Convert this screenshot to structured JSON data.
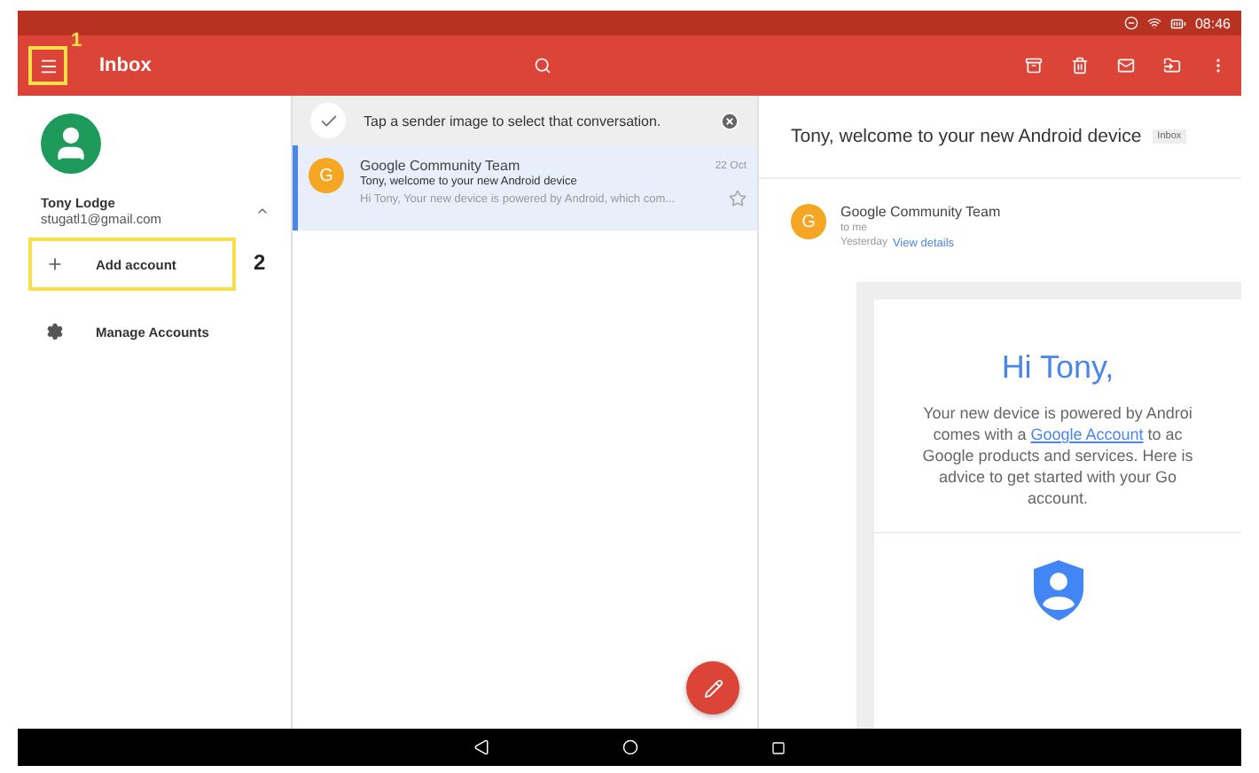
{
  "status_bar": {
    "time": "08:46"
  },
  "toolbar": {
    "title": "Inbox"
  },
  "drawer": {
    "account_name": "Tony Lodge",
    "account_email": "stugatl1@gmail.com",
    "items": [
      {
        "kind": "add",
        "label": "Add account",
        "highlighted": true
      },
      {
        "kind": "manage",
        "label": "Manage Accounts",
        "highlighted": false
      }
    ]
  },
  "callouts": [
    {
      "label": "1"
    },
    {
      "label": "2"
    }
  ],
  "tip": {
    "text": "Tap a sender image to select that conversation."
  },
  "messages": [
    {
      "initial": "G",
      "sender": "Google Community Team",
      "date": "22 Oct",
      "subject": "Tony, welcome to your new Android device",
      "snippet": "Hi Tony, Your new device is powered by Android, which com...",
      "selected": true,
      "starred": false
    }
  ],
  "reader": {
    "subject": "Tony, welcome to your new Android device",
    "label": "Inbox",
    "initial": "G",
    "sender": "Google Community Team",
    "to": "to me",
    "when": "Yesterday",
    "details_link": "View details",
    "greeting": "Hi Tony,",
    "body_lines": [
      "Your new device is powered by Androi",
      "comes with a **Google Account** to ac",
      "Google products and services. Here is",
      "advice to get started with your Go",
      "account."
    ]
  }
}
